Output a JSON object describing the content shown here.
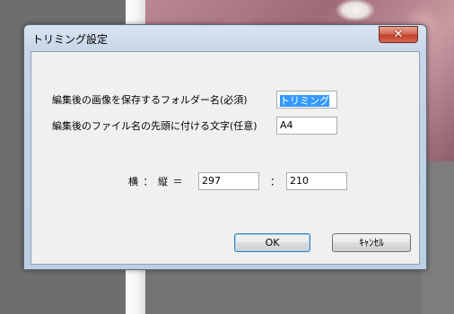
{
  "dialog": {
    "title": "トリミング設定",
    "close_glyph": "✕"
  },
  "form": {
    "folder_label": "編集後の画像を保存するフォルダー名(必須)",
    "folder_value": "トリミング",
    "filename_label": "編集後のファイル名の先頭に付ける文字(任意)",
    "filename_value": "A4",
    "ratio_label": "横 ： 縦 ＝",
    "width_value": "297",
    "ratio_separator": "：",
    "height_value": "210"
  },
  "buttons": {
    "ok_label": "OK",
    "cancel_label": "ｷｬﾝｾﾙ"
  }
}
